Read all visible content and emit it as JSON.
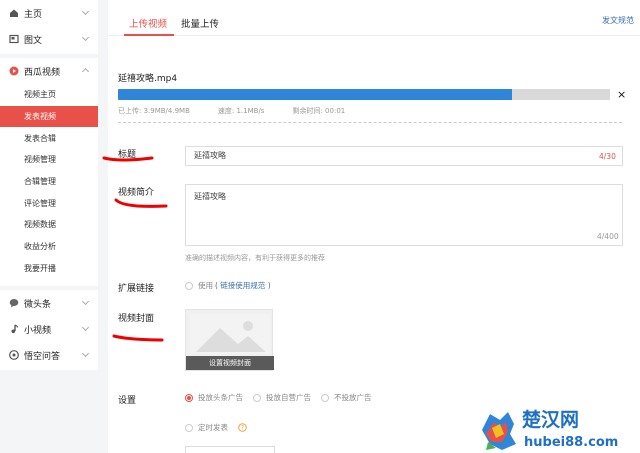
{
  "sidebar": {
    "top_items": [
      {
        "label": "主页",
        "icon": "home-icon"
      },
      {
        "label": "图文",
        "icon": "article-icon"
      }
    ],
    "video_section": {
      "label": "西瓜视频",
      "icon": "play-icon",
      "items": [
        "视频主页",
        "发表视频",
        "发表合辑",
        "视频管理",
        "合辑管理",
        "评论管理",
        "视频数据",
        "收益分析",
        "我要开播"
      ],
      "active_index": 1
    },
    "bottom_items": [
      {
        "label": "微头条",
        "icon": "chat-icon"
      },
      {
        "label": "小视频",
        "icon": "music-icon"
      },
      {
        "label": "悟空问答",
        "icon": "question-icon"
      }
    ]
  },
  "tabs": [
    "上传视频",
    "批量上传"
  ],
  "spec_link": "发文规范",
  "upload": {
    "filename": "延禧攻略.mp4",
    "progress": 0.8,
    "uploaded": "已上传: 3.9MB/4.9MB",
    "speed": "速度: 1.1MB/s",
    "remaining": "剩余时间: 00:01",
    "close": "×"
  },
  "form": {
    "title_label": "标题",
    "title_value": "延禧攻略",
    "title_count": "4/30",
    "intro_label": "视频简介",
    "intro_value": "延禧攻略",
    "intro_count": "4/400",
    "intro_hint": "准确的描述视频内容，有利于获得更多的推荐",
    "ext_label": "扩展链接",
    "ext_use": "使用",
    "ext_spec": "( 链接使用规范 )",
    "cover_label": "视频封面",
    "cover_button": "设置视频封面",
    "settings_label": "设置",
    "ad_options": [
      "投放头条广告",
      "投放自营广告",
      "不投放广告"
    ],
    "ad_selected": 0,
    "schedule": "定时发表"
  },
  "watermark": {
    "name": "楚汉网",
    "url": "hubei88.com"
  },
  "colors": {
    "accent": "#e8504a",
    "progress": "#2f86d8",
    "link": "#3a6fb0"
  }
}
